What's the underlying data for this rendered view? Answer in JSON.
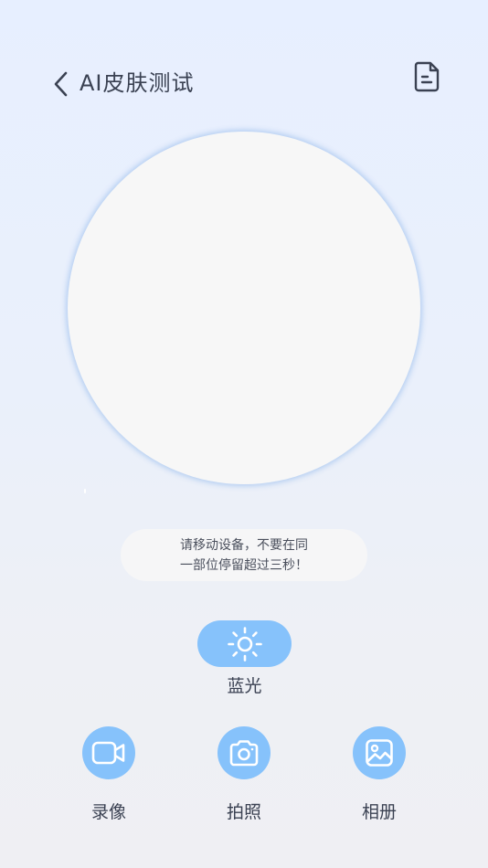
{
  "header": {
    "title": "AI皮肤测试",
    "back_icon": "chevron-left-icon",
    "report_icon": "document-icon"
  },
  "tip": {
    "line1": "请移动设备，不要在同",
    "line2": "一部位停留超过三秒！"
  },
  "light": {
    "icon": "sun-icon",
    "label": "蓝光"
  },
  "actions": [
    {
      "icon": "video-icon",
      "label": "录像"
    },
    {
      "icon": "camera-icon",
      "label": "拍照"
    },
    {
      "icon": "image-icon",
      "label": "相册"
    }
  ],
  "colors": {
    "accent": "#86c2fb",
    "text": "#3a4152",
    "camera_bg": "#f7f7f7"
  }
}
